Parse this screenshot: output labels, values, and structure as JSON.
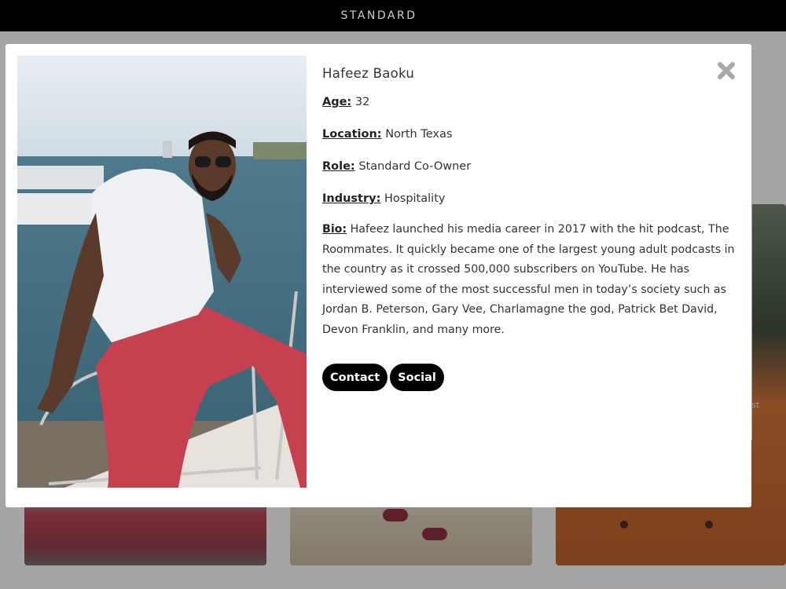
{
  "header": {
    "brand": "STANDARD"
  },
  "background": {
    "partial_caption": "st"
  },
  "modal": {
    "name": "Hafeez Baoku",
    "fields": [
      {
        "label": "Age:",
        "value": "32"
      },
      {
        "label": "Location:",
        "value": "North Texas"
      },
      {
        "label": "Role:",
        "value": "Standard Co-Owner"
      },
      {
        "label": "Industry:",
        "value": "Hospitality"
      }
    ],
    "bio": {
      "label": "Bio:",
      "text": "Hafeez launched his media career in 2017 with the hit podcast, The Roommates. It quickly became one of the largest young adult podcasts in the country as it crossed 500,000 subscribers on YouTube. He has interviewed some of the most successful men in today’s society such as Jordan B. Peterson, Gary Vee, Charlamagne the god, Patrick Bet David, Devon Franklin, and many more."
    },
    "buttons": {
      "contact": "Contact",
      "social": "Social"
    },
    "close_icon": "close-x-icon"
  },
  "colors": {
    "topbar": "#000000",
    "button_bg": "#000000",
    "button_text": "#ffffff",
    "close_icon": "#a8a8a8"
  }
}
